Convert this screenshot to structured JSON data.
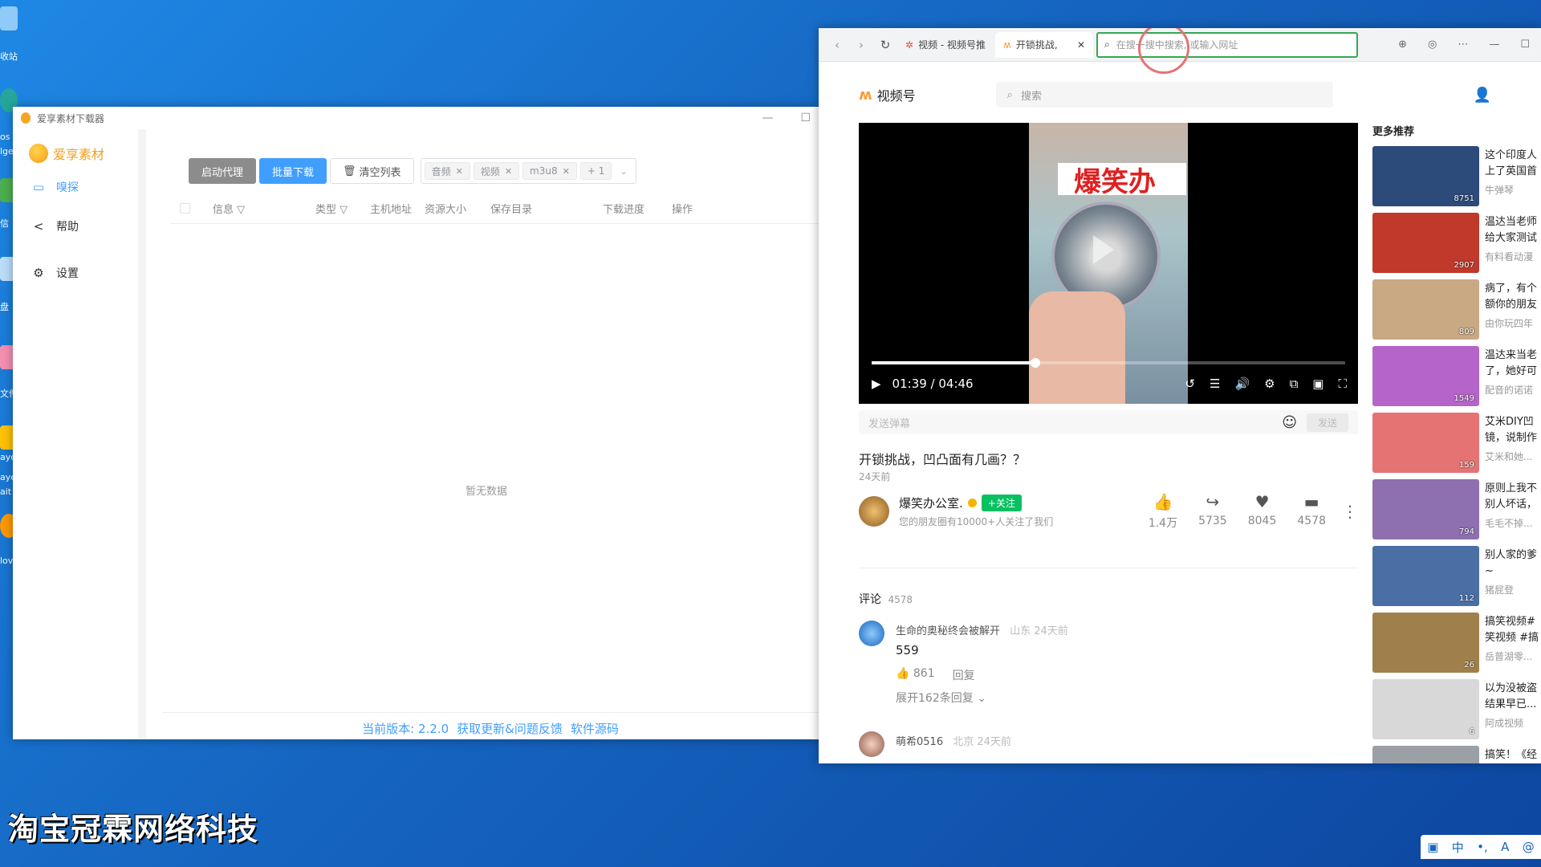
{
  "desktop": {
    "watermark_text": "淘宝冠霖网络科技",
    "icon_labels": [
      "收站",
      "os",
      "lge",
      "信",
      "盘",
      "文件",
      "aye",
      "ayer",
      "ait",
      "lov"
    ]
  },
  "tray": {
    "items": [
      "tray-app",
      "中",
      "•,",
      "A",
      "@"
    ]
  },
  "downloader": {
    "title": "爱享素材下载器",
    "brand": "爱享素材",
    "nav": [
      {
        "label": "嗅探",
        "icon": "camera-icon"
      },
      {
        "label": "帮助",
        "icon": "share-icon"
      },
      {
        "label": "设置",
        "icon": "gear-icon"
      }
    ],
    "toolbar": {
      "proxy_label": "启动代理",
      "batch_label": "批量下载",
      "clear_label": "清空列表",
      "filter_tags": [
        "音频",
        "视频",
        "m3u8"
      ],
      "filter_more": "+ 1"
    },
    "table_headers": [
      "信息",
      "类型",
      "主机地址",
      "资源大小",
      "保存目录",
      "下载进度",
      "操作"
    ],
    "empty_text": "暂无数据",
    "footer": {
      "version": "当前版本: 2.2.0",
      "update": "获取更新&问题反馈",
      "source": "软件源码"
    }
  },
  "browser": {
    "tabs": [
      {
        "label": "视频 - 视频号推",
        "active": false
      },
      {
        "label": "开锁挑战,",
        "active": true
      }
    ],
    "address_placeholder": "在搜一搜中搜索, 或输入网址",
    "site": {
      "logo": "视频号",
      "search_placeholder": "搜索"
    },
    "player": {
      "sign_text": "爆笑办",
      "time": "01:39 / 04:46",
      "progress": 0.346
    },
    "danmu_placeholder": "发送弹幕",
    "danmu_send": "发送",
    "video_title": "开锁挑战，凹凸面有几画？？",
    "video_age": "24天前",
    "author": {
      "name": "爆笑办公室.",
      "follow": "+关注",
      "sub": "您的朋友圈有10000+人关注了我们"
    },
    "stats": [
      {
        "icon": "thumbs-up-icon",
        "glyph": "👍",
        "value": "1.4万"
      },
      {
        "icon": "share-icon",
        "glyph": "↪",
        "value": "5735"
      },
      {
        "icon": "heart-icon",
        "glyph": "♥",
        "value": "8045"
      },
      {
        "icon": "comment-icon",
        "glyph": "▬",
        "value": "4578"
      }
    ],
    "comments_title": "评论",
    "comments_count": "4578",
    "comments": [
      {
        "user": "生命的奥秘终会被解开",
        "meta": "山东 24天前",
        "text": "559",
        "likes": "861",
        "reply": "回复",
        "expand": "展开162条回复"
      },
      {
        "user": "萌希0516",
        "meta": "北京 24天前",
        "text": ""
      }
    ],
    "recs_title": "更多推荐",
    "recs": [
      {
        "title": "这个印度人上了英国首",
        "author": "牛弹琴",
        "likes": "8751",
        "color": "#2c4a7a"
      },
      {
        "title": "温达当老师给大家测试",
        "author": "有料看动漫",
        "likes": "2907",
        "color": "#c0392b"
      },
      {
        "title": "病了，有个额你的朋友",
        "author": "由你玩四年",
        "likes": "809",
        "color": "#c9a884"
      },
      {
        "title": "温达来当老了，她好可",
        "author": "配音的诺诺",
        "likes": "1549",
        "color": "#b565c9"
      },
      {
        "title": "艾米DIY凹镜，说制作",
        "author": "艾米和她...",
        "likes": "159",
        "color": "#e57373"
      },
      {
        "title": "原则上我不别人坏话，",
        "author": "毛毛不掉...",
        "likes": "794",
        "color": "#8e6fb0"
      },
      {
        "title": "别人家的爹~",
        "author": "猪屁登",
        "likes": "112",
        "color": "#4a6fa5"
      },
      {
        "title": "搞笑视频#笑视频 #搞",
        "author": "岳普湖零...",
        "likes": "26",
        "color": "#a0804a"
      },
      {
        "title": "以为没被盗结果早已...",
        "author": "阿成视频",
        "likes": "6",
        "color": "#d8d8d8"
      },
      {
        "title": "搞笑！《经",
        "author": "",
        "likes": "",
        "color": "#9aa0a6"
      }
    ]
  }
}
